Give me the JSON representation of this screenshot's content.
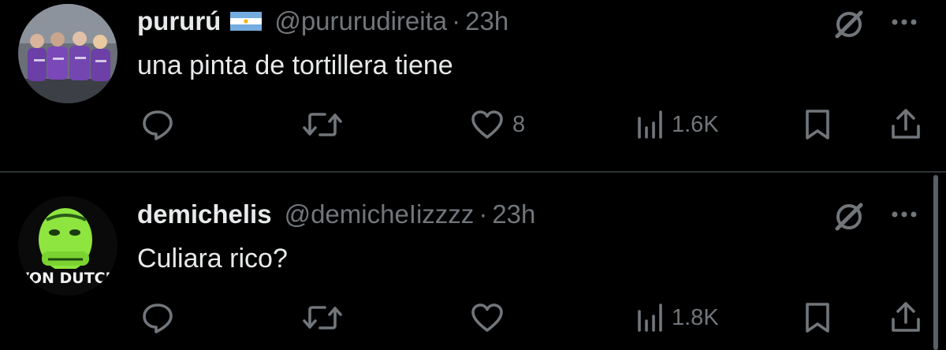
{
  "tweets": [
    {
      "display_name": "pururú",
      "flag_icon": "argentina-flag-icon",
      "handle": "@pururudireita",
      "separator": "·",
      "time": "23h",
      "text": "una pinta de tortillera tiene",
      "replies": "",
      "retweets": "",
      "likes": "8",
      "views": "1.6K"
    },
    {
      "display_name": "demichelis",
      "handle": "@demicheIizzzz",
      "separator": "·",
      "time": "23h",
      "text": "Culiara rico?",
      "avatar_text": "VON DUTCH",
      "replies": "",
      "retweets": "",
      "likes": "",
      "views": "1.8K"
    }
  ],
  "colors": {
    "background": "#000000",
    "primary_text": "#e7e9ea",
    "secondary_text": "#71767b",
    "divider": "#2f3336",
    "flag_blue": "#74acdf",
    "flag_sun": "#f6b40e"
  }
}
